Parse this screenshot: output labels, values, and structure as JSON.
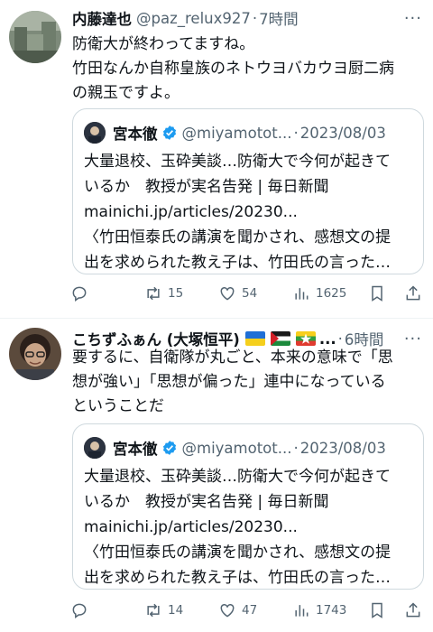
{
  "tweets": [
    {
      "name": "内藤達也",
      "handle": "@paz_relux927",
      "time": "7時間",
      "more": "···",
      "body": [
        "防衛大が終わってますね。",
        "竹田なんか自称皇族のネトウヨバカウヨ厨二病",
        "の親玉ですよ。"
      ],
      "quote": {
        "name": "宮本徹",
        "handle": "@miyamotot...",
        "date": "2023/08/03",
        "body": [
          "大量退校、玉砕美談…防衛大で今何が起きて",
          "いるか　教授が実名告発 | 毎日新聞",
          "mainichi.jp/articles/20230...",
          "〈竹田恒泰氏の講演を聞かされ、感想文の提",
          "出を求められた教え子は、竹田氏の言った…"
        ]
      },
      "stats": {
        "retweets": "15",
        "likes": "54",
        "views": "1625"
      }
    },
    {
      "name": "こちずふぁん (大塚恒平)",
      "handle": "",
      "time": "6時間",
      "more": "···",
      "name_suffix": "...",
      "body": [
        "要するに、自衛隊が丸ごと、本来の意味で「思",
        "想が強い」「思想が偏った」連中になっている",
        "ということだ"
      ],
      "quote": {
        "name": "宮本徹",
        "handle": "@miyamotot...",
        "date": "2023/08/03",
        "body": [
          "大量退校、玉砕美談…防衛大で今何が起きて",
          "いるか　教授が実名告発 | 毎日新聞",
          "mainichi.jp/articles/20230...",
          "〈竹田恒泰氏の講演を聞かされ、感想文の提",
          "出を求められた教え子は、竹田氏の言った…"
        ]
      },
      "stats": {
        "retweets": "14",
        "likes": "47",
        "views": "1743"
      }
    }
  ],
  "colors": {
    "text": "#0f1419",
    "secondary": "#536471",
    "border": "#cfd9de",
    "verified": "#1d9bf0"
  },
  "icons": [
    "reply-icon",
    "retweet-icon",
    "like-icon",
    "views-icon",
    "bookmark-icon",
    "share-icon",
    "verified-icon"
  ]
}
